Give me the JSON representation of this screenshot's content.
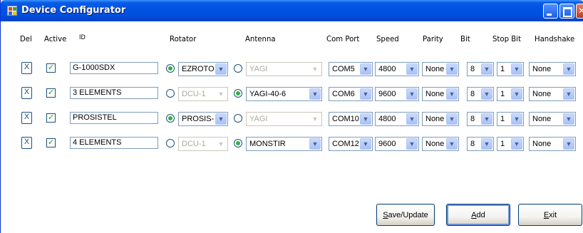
{
  "window": {
    "title": "Device Configurator"
  },
  "headers": {
    "del": "Del",
    "active": "Active",
    "id": "ID",
    "rotator": "Rotator",
    "antenna": "Antenna",
    "com_port": "Com Port",
    "speed": "Speed",
    "parity": "Parity",
    "bit": "Bit",
    "stop_bit": "Stop Bit",
    "handshake": "Handshake"
  },
  "rows": [
    {
      "del": "X",
      "active": true,
      "id": "G-1000SDX",
      "rotator_selected": true,
      "rotator": "EZROTO",
      "rotator_enabled": true,
      "antenna_selected": false,
      "antenna": "YAGI",
      "antenna_enabled": false,
      "com_port": "COM5",
      "speed": "4800",
      "parity": "None",
      "bit": "8",
      "stop_bit": "1",
      "handshake": "None"
    },
    {
      "del": "X",
      "active": true,
      "id": "3 ELEMENTS",
      "rotator_selected": false,
      "rotator": "DCU-1",
      "rotator_enabled": false,
      "antenna_selected": true,
      "antenna": "YAGI-40-6",
      "antenna_enabled": true,
      "com_port": "COM6",
      "speed": "9600",
      "parity": "None",
      "bit": "8",
      "stop_bit": "1",
      "handshake": "None"
    },
    {
      "del": "X",
      "active": true,
      "id": "PROSISTEL",
      "rotator_selected": true,
      "rotator": "PROSIS-I",
      "rotator_enabled": true,
      "antenna_selected": false,
      "antenna": "YAGI",
      "antenna_enabled": false,
      "com_port": "COM10",
      "speed": "4800",
      "parity": "None",
      "bit": "8",
      "stop_bit": "1",
      "handshake": "None"
    },
    {
      "del": "X",
      "active": true,
      "id": "4 ELEMENTS",
      "rotator_selected": false,
      "rotator": "DCU-1",
      "rotator_enabled": false,
      "antenna_selected": true,
      "antenna": "MONSTIR",
      "antenna_enabled": true,
      "com_port": "COM12",
      "speed": "9600",
      "parity": "None",
      "bit": "8",
      "stop_bit": "1",
      "handshake": "None"
    }
  ],
  "buttons": {
    "save_update": "Save/Update",
    "add": "Add",
    "exit": "Exit"
  },
  "colors": {
    "titlebar": "#0054e3",
    "check": "#21a121",
    "radio_on": "#31b23c"
  },
  "icons": {
    "delete": "close-x-icon",
    "active": "checkmark-icon",
    "dropdown": "chevron-down-icon"
  }
}
